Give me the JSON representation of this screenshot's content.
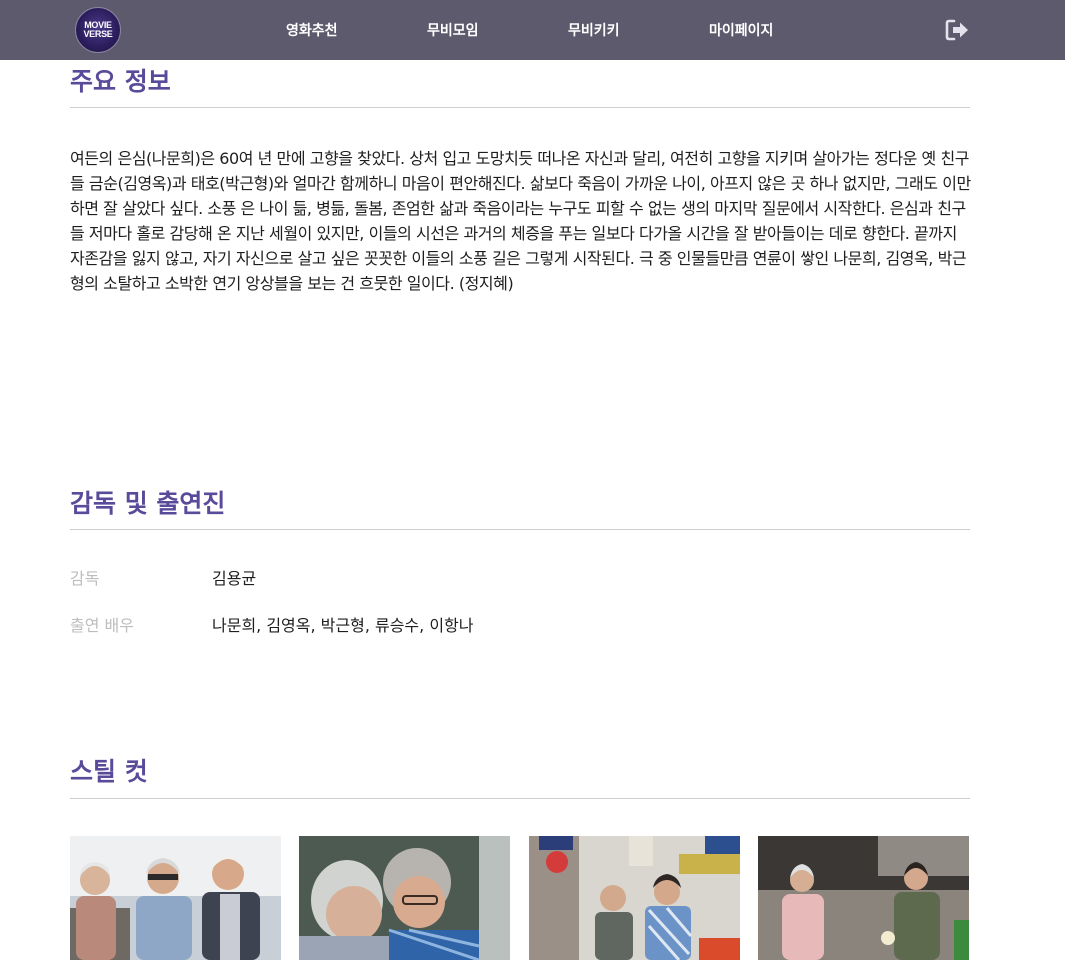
{
  "nav": {
    "logo_line1": "MOVIE",
    "logo_line2": "VERSE",
    "items": [
      "영화추천",
      "무비모임",
      "무비키키",
      "마이페이지"
    ],
    "logout_icon": "sign-out-icon"
  },
  "overview": {
    "title": "주요 정보",
    "synopsis": "여든의 은심(나문희)은 60여 년 만에 고향을 찾았다. 상처 입고 도망치듯 떠나온 자신과 달리, 여전히 고향을 지키며 살아가는 정다운 옛 친구들 금순(김영옥)과 태호(박근형)와 얼마간 함께하니 마음이 편안해진다. 삶보다 죽음이 가까운 나이, 아프지 않은 곳 하나 없지만, 그래도 이만하면 잘 살았다 싶다. 소풍 은 나이 듦, 병듦, 돌봄, 존엄한 삶과 죽음이라는 누구도 피할 수 없는 생의 마지막 질문에서 시작한다. 은심과 친구들 저마다 홀로 감당해 온 지난 세월이 있지만, 이들의 시선은 과거의 체증을 푸는 일보다 다가올 시간을 잘 받아들이는 데로 향한다. 끝까지 자존감을 잃지 않고, 자기 자신으로 살고 싶은 꼿꼿한 이들의 소풍 길은 그렇게 시작된다. 극 중 인물들만큼 연륜이 쌓인 나문희, 김영옥, 박근형의 소탈하고 소박한 연기 앙상블을 보는 건 흐뭇한 일이다. (정지혜)"
  },
  "credits": {
    "title": "감독 및 출연진",
    "director_label": "감독",
    "director": "김용균",
    "cast_label": "출연 배우",
    "cast": "나문희, 김영옥, 박근형, 류승수, 이항나"
  },
  "stills": {
    "title": "스틸 컷",
    "images": [
      "still-image-1",
      "still-image-2",
      "still-image-3",
      "still-image-4"
    ]
  },
  "colors": {
    "nav_bg": "#5e5a6e",
    "accent": "#5a4a9a",
    "label_gray": "#bdbdbd"
  }
}
